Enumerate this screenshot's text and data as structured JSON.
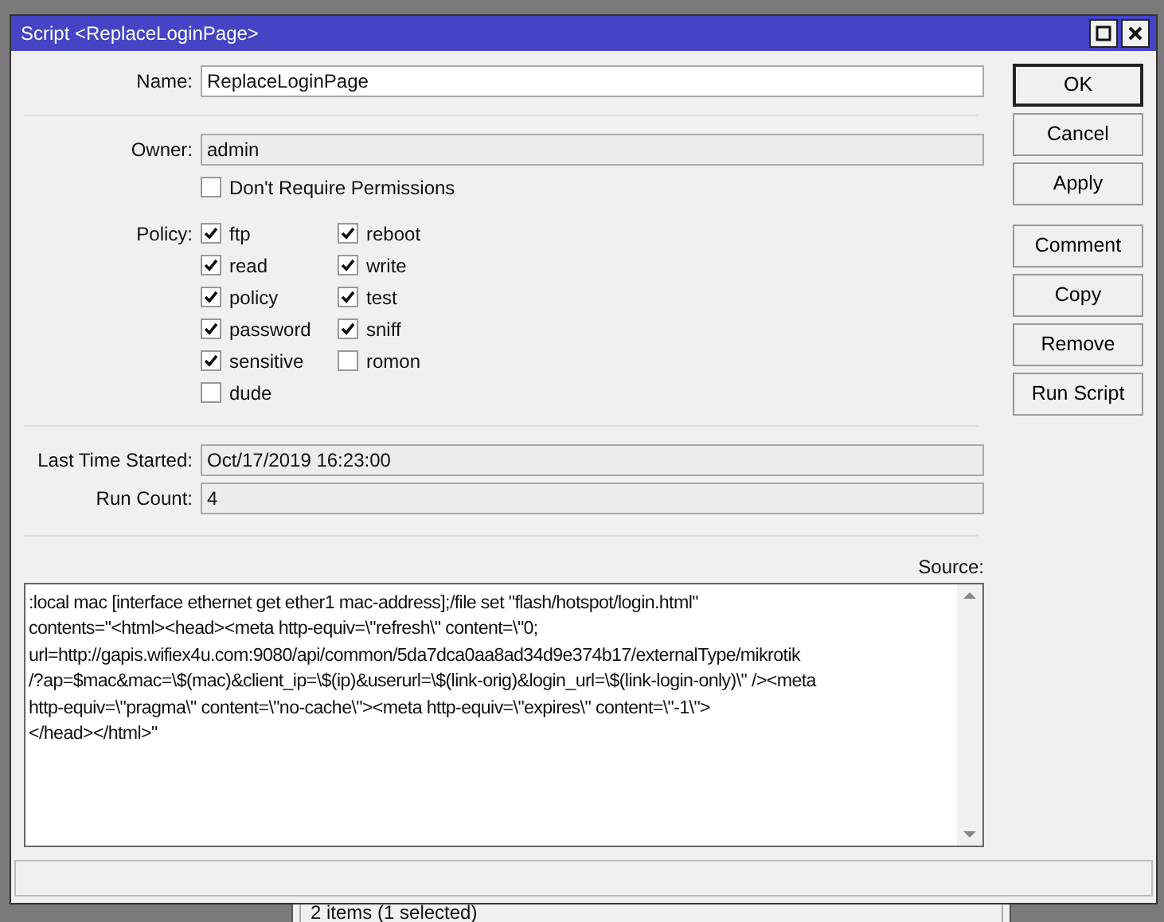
{
  "window": {
    "title": "Script <ReplaceLoginPage>"
  },
  "fields": {
    "name": {
      "label": "Name:",
      "value": "ReplaceLoginPage"
    },
    "owner": {
      "label": "Owner:",
      "value": "admin"
    }
  },
  "dont_require_permissions": {
    "label": "Don't Require Permissions",
    "checked": false
  },
  "policy": {
    "label": "Policy:",
    "columns": [
      [
        {
          "label": "ftp",
          "checked": true
        },
        {
          "label": "read",
          "checked": true
        },
        {
          "label": "policy",
          "checked": true
        },
        {
          "label": "password",
          "checked": true
        },
        {
          "label": "sensitive",
          "checked": true
        },
        {
          "label": "dude",
          "checked": false
        }
      ],
      [
        {
          "label": "reboot",
          "checked": true
        },
        {
          "label": "write",
          "checked": true
        },
        {
          "label": "test",
          "checked": true
        },
        {
          "label": "sniff",
          "checked": true
        },
        {
          "label": "romon",
          "checked": false
        }
      ]
    ]
  },
  "stats": [
    {
      "label": "Last Time Started:",
      "value": "Oct/17/2019 16:23:00"
    },
    {
      "label": "Run Count:",
      "value": "4"
    }
  ],
  "source": {
    "label": "Source:",
    "lines": [
      ":local mac [interface ethernet get ether1 mac-address];/file set \"flash/hotspot/login.html\"",
      "contents=\"<html><head><meta http-equiv=\\\"refresh\\\" content=\\\"0;",
      "url=http://gapis.wifiex4u.com:9080/api/common/5da7dca0aa8ad34d9e374b17/externalType/mikrotik",
      "/?ap=$mac&mac=\\$(mac)&client_ip=\\$(ip)&userurl=\\$(link-orig)&login_url=\\$(link-login-only)\\\" /><meta",
      "http-equiv=\\\"pragma\\\" content=\\\"no-cache\\\"><meta http-equiv=\\\"expires\\\" content=\\\"-1\\\">",
      "</head></html>\""
    ]
  },
  "buttons": [
    {
      "label": "OK",
      "default": true
    },
    {
      "label": "Cancel",
      "default": false
    },
    {
      "label": "Apply",
      "default": false
    },
    {
      "label": "Comment",
      "default": false
    },
    {
      "label": "Copy",
      "default": false
    },
    {
      "label": "Remove",
      "default": false
    },
    {
      "label": "Run Script",
      "default": false
    }
  ],
  "background_window": {
    "status": "2 items (1 selected)"
  }
}
